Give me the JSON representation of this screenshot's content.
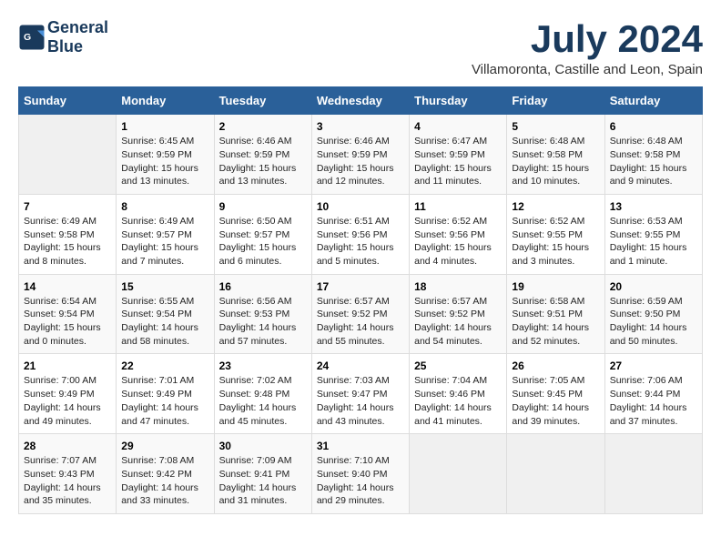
{
  "header": {
    "logo_line1": "General",
    "logo_line2": "Blue",
    "month": "July 2024",
    "location": "Villamoronta, Castille and Leon, Spain"
  },
  "days_of_week": [
    "Sunday",
    "Monday",
    "Tuesday",
    "Wednesday",
    "Thursday",
    "Friday",
    "Saturday"
  ],
  "weeks": [
    [
      {
        "day": "",
        "info": ""
      },
      {
        "day": "1",
        "info": "Sunrise: 6:45 AM\nSunset: 9:59 PM\nDaylight: 15 hours\nand 13 minutes."
      },
      {
        "day": "2",
        "info": "Sunrise: 6:46 AM\nSunset: 9:59 PM\nDaylight: 15 hours\nand 13 minutes."
      },
      {
        "day": "3",
        "info": "Sunrise: 6:46 AM\nSunset: 9:59 PM\nDaylight: 15 hours\nand 12 minutes."
      },
      {
        "day": "4",
        "info": "Sunrise: 6:47 AM\nSunset: 9:59 PM\nDaylight: 15 hours\nand 11 minutes."
      },
      {
        "day": "5",
        "info": "Sunrise: 6:48 AM\nSunset: 9:58 PM\nDaylight: 15 hours\nand 10 minutes."
      },
      {
        "day": "6",
        "info": "Sunrise: 6:48 AM\nSunset: 9:58 PM\nDaylight: 15 hours\nand 9 minutes."
      }
    ],
    [
      {
        "day": "7",
        "info": "Sunrise: 6:49 AM\nSunset: 9:58 PM\nDaylight: 15 hours\nand 8 minutes."
      },
      {
        "day": "8",
        "info": "Sunrise: 6:49 AM\nSunset: 9:57 PM\nDaylight: 15 hours\nand 7 minutes."
      },
      {
        "day": "9",
        "info": "Sunrise: 6:50 AM\nSunset: 9:57 PM\nDaylight: 15 hours\nand 6 minutes."
      },
      {
        "day": "10",
        "info": "Sunrise: 6:51 AM\nSunset: 9:56 PM\nDaylight: 15 hours\nand 5 minutes."
      },
      {
        "day": "11",
        "info": "Sunrise: 6:52 AM\nSunset: 9:56 PM\nDaylight: 15 hours\nand 4 minutes."
      },
      {
        "day": "12",
        "info": "Sunrise: 6:52 AM\nSunset: 9:55 PM\nDaylight: 15 hours\nand 3 minutes."
      },
      {
        "day": "13",
        "info": "Sunrise: 6:53 AM\nSunset: 9:55 PM\nDaylight: 15 hours\nand 1 minute."
      }
    ],
    [
      {
        "day": "14",
        "info": "Sunrise: 6:54 AM\nSunset: 9:54 PM\nDaylight: 15 hours\nand 0 minutes."
      },
      {
        "day": "15",
        "info": "Sunrise: 6:55 AM\nSunset: 9:54 PM\nDaylight: 14 hours\nand 58 minutes."
      },
      {
        "day": "16",
        "info": "Sunrise: 6:56 AM\nSunset: 9:53 PM\nDaylight: 14 hours\nand 57 minutes."
      },
      {
        "day": "17",
        "info": "Sunrise: 6:57 AM\nSunset: 9:52 PM\nDaylight: 14 hours\nand 55 minutes."
      },
      {
        "day": "18",
        "info": "Sunrise: 6:57 AM\nSunset: 9:52 PM\nDaylight: 14 hours\nand 54 minutes."
      },
      {
        "day": "19",
        "info": "Sunrise: 6:58 AM\nSunset: 9:51 PM\nDaylight: 14 hours\nand 52 minutes."
      },
      {
        "day": "20",
        "info": "Sunrise: 6:59 AM\nSunset: 9:50 PM\nDaylight: 14 hours\nand 50 minutes."
      }
    ],
    [
      {
        "day": "21",
        "info": "Sunrise: 7:00 AM\nSunset: 9:49 PM\nDaylight: 14 hours\nand 49 minutes."
      },
      {
        "day": "22",
        "info": "Sunrise: 7:01 AM\nSunset: 9:49 PM\nDaylight: 14 hours\nand 47 minutes."
      },
      {
        "day": "23",
        "info": "Sunrise: 7:02 AM\nSunset: 9:48 PM\nDaylight: 14 hours\nand 45 minutes."
      },
      {
        "day": "24",
        "info": "Sunrise: 7:03 AM\nSunset: 9:47 PM\nDaylight: 14 hours\nand 43 minutes."
      },
      {
        "day": "25",
        "info": "Sunrise: 7:04 AM\nSunset: 9:46 PM\nDaylight: 14 hours\nand 41 minutes."
      },
      {
        "day": "26",
        "info": "Sunrise: 7:05 AM\nSunset: 9:45 PM\nDaylight: 14 hours\nand 39 minutes."
      },
      {
        "day": "27",
        "info": "Sunrise: 7:06 AM\nSunset: 9:44 PM\nDaylight: 14 hours\nand 37 minutes."
      }
    ],
    [
      {
        "day": "28",
        "info": "Sunrise: 7:07 AM\nSunset: 9:43 PM\nDaylight: 14 hours\nand 35 minutes."
      },
      {
        "day": "29",
        "info": "Sunrise: 7:08 AM\nSunset: 9:42 PM\nDaylight: 14 hours\nand 33 minutes."
      },
      {
        "day": "30",
        "info": "Sunrise: 7:09 AM\nSunset: 9:41 PM\nDaylight: 14 hours\nand 31 minutes."
      },
      {
        "day": "31",
        "info": "Sunrise: 7:10 AM\nSunset: 9:40 PM\nDaylight: 14 hours\nand 29 minutes."
      },
      {
        "day": "",
        "info": ""
      },
      {
        "day": "",
        "info": ""
      },
      {
        "day": "",
        "info": ""
      }
    ]
  ]
}
